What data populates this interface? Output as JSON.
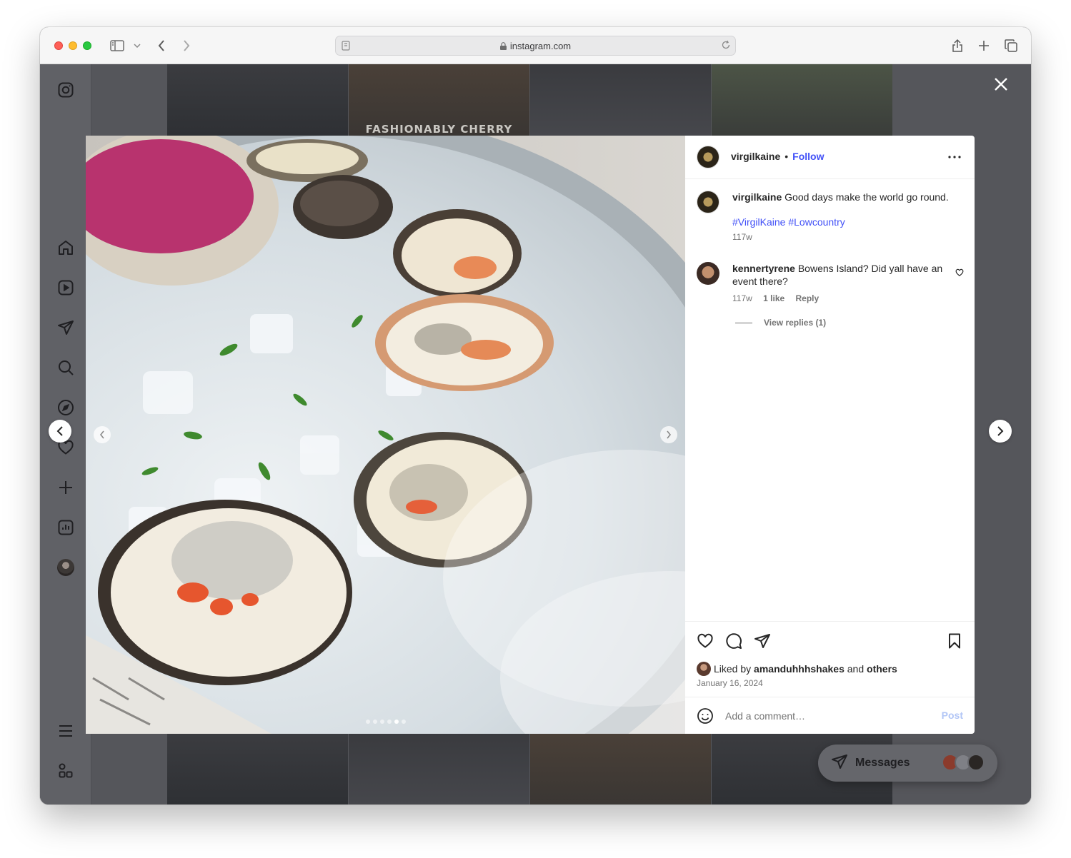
{
  "browser": {
    "url": "instagram.com"
  },
  "background": {
    "tile_text": "FASHIONABLY CHERRY"
  },
  "post": {
    "username": "virgilkaine",
    "separator": "•",
    "follow_label": "Follow",
    "caption": {
      "username": "virgilkaine",
      "text": "Good days make the world go round.",
      "hashtags": "#VirgilKaine #Lowcountry",
      "age": "117w"
    },
    "comment": {
      "username": "kennertyrene",
      "text": "Bowens Island? Did yall have an event there?",
      "age": "117w",
      "likes": "1 like",
      "reply_label": "Reply",
      "view_replies": "View replies (1)"
    },
    "liked_by_prefix": "Liked by",
    "liked_by_user": "amanduhhhshakes",
    "liked_by_and": "and",
    "liked_by_others": "others",
    "date": "January 16, 2024",
    "comment_placeholder": "Add a comment…",
    "post_label": "Post",
    "carousel": {
      "count": 6,
      "active_index": 4
    }
  },
  "messages": {
    "label": "Messages"
  },
  "colors": {
    "link_blue": "#4150f7",
    "post_disabled": "#b2c6f6"
  }
}
